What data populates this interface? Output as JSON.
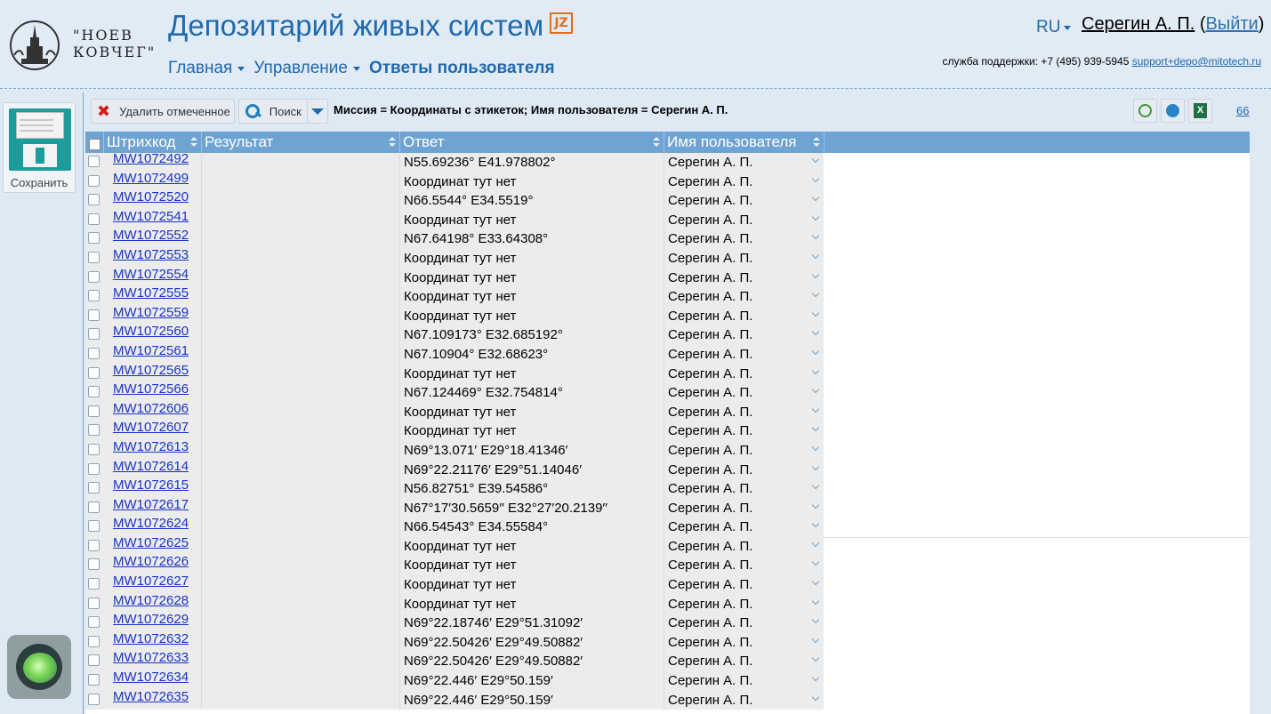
{
  "header": {
    "logo_text_line1": "\"НОЕВ",
    "logo_text_line2": "КОВЧЕГ\"",
    "title": "Депозитарий живых систем",
    "badge": "JZ",
    "nav": [
      {
        "label": "Главная",
        "dropdown": true
      },
      {
        "label": "Управление",
        "dropdown": true
      },
      {
        "label": "Ответы пользователя",
        "dropdown": false,
        "active": true
      }
    ],
    "lang": "RU",
    "user_name": "Серегин А. П.",
    "logout_open": "(",
    "logout_label": "Выйти",
    "logout_close": ")",
    "support_label": "служба поддержки: +7 (495) 939-5945",
    "support_email": "support+depo@mitotech.ru"
  },
  "sidebar": {
    "save_label": "Сохранить"
  },
  "toolbar": {
    "delete_label": "Удалить отмеченное",
    "search_label": "Поиск",
    "filter_text": "Миссия = Координаты с этикеток; Имя пользователя = Серегин А. П.",
    "count": "66"
  },
  "columns": [
    "Штрихкод",
    "Результат",
    "Ответ",
    "Имя пользователя"
  ],
  "rows": [
    {
      "barcode": "MW1072492",
      "answer": "N55.69236° E41.978802°",
      "user": "Серегин А. П."
    },
    {
      "barcode": "MW1072499",
      "answer": "Координат тут нет",
      "user": "Серегин А. П."
    },
    {
      "barcode": "MW1072520",
      "answer": "N66.5544° E34.5519°",
      "user": "Серегин А. П."
    },
    {
      "barcode": "MW1072541",
      "answer": "Координат тут нет",
      "user": "Серегин А. П."
    },
    {
      "barcode": "MW1072552",
      "answer": "N67.64198° E33.64308°",
      "user": "Серегин А. П."
    },
    {
      "barcode": "MW1072553",
      "answer": "Координат тут нет",
      "user": "Серегин А. П."
    },
    {
      "barcode": "MW1072554",
      "answer": "Координат тут нет",
      "user": "Серегин А. П."
    },
    {
      "barcode": "MW1072555",
      "answer": "Координат тут нет",
      "user": "Серегин А. П."
    },
    {
      "barcode": "MW1072559",
      "answer": "Координат тут нет",
      "user": "Серегин А. П."
    },
    {
      "barcode": "MW1072560",
      "answer": "N67.109173° E32.685192°",
      "user": "Серегин А. П."
    },
    {
      "barcode": "MW1072561",
      "answer": "N67.10904° E32.68623°",
      "user": "Серегин А. П."
    },
    {
      "barcode": "MW1072565",
      "answer": "Координат тут нет",
      "user": "Серегин А. П."
    },
    {
      "barcode": "MW1072566",
      "answer": "N67.124469° E32.754814°",
      "user": "Серегин А. П."
    },
    {
      "barcode": "MW1072606",
      "answer": "Координат тут нет",
      "user": "Серегин А. П."
    },
    {
      "barcode": "MW1072607",
      "answer": "Координат тут нет",
      "user": "Серегин А. П."
    },
    {
      "barcode": "MW1072613",
      "answer": "N69°13.071′ E29°18.41346′",
      "user": "Серегин А. П."
    },
    {
      "barcode": "MW1072614",
      "answer": "N69°22.21176′ E29°51.14046′",
      "user": "Серегин А. П."
    },
    {
      "barcode": "MW1072615",
      "answer": "N56.82751° E39.54586°",
      "user": "Серегин А. П."
    },
    {
      "barcode": "MW1072617",
      "answer": "N67°17′30.5659′′ E32°27′20.2139′′",
      "user": "Серегин А. П."
    },
    {
      "barcode": "MW1072624",
      "answer": "N66.54543° E34.55584°",
      "user": "Серегин А. П."
    },
    {
      "barcode": "MW1072625",
      "answer": "Координат тут нет",
      "user": "Серегин А. П."
    },
    {
      "barcode": "MW1072626",
      "answer": "Координат тут нет",
      "user": "Серегин А. П."
    },
    {
      "barcode": "MW1072627",
      "answer": "Координат тут нет",
      "user": "Серегин А. П."
    },
    {
      "barcode": "MW1072628",
      "answer": "Координат тут нет",
      "user": "Серегин А. П."
    },
    {
      "barcode": "MW1072629",
      "answer": "N69°22.18746′ E29°51.31092′",
      "user": "Серегин А. П."
    },
    {
      "barcode": "MW1072632",
      "answer": "N69°22.50426′ E29°49.50882′",
      "user": "Серегин А. П."
    },
    {
      "barcode": "MW1072633",
      "answer": "N69°22.50426′ E29°49.50882′",
      "user": "Серегин А. П."
    },
    {
      "barcode": "MW1072634",
      "answer": "N69°22.446′ E29°50.159′",
      "user": "Серегин А. П."
    },
    {
      "barcode": "MW1072635",
      "answer": "N69°22.446′ E29°50.159′",
      "user": "Серегин А. П."
    }
  ]
}
